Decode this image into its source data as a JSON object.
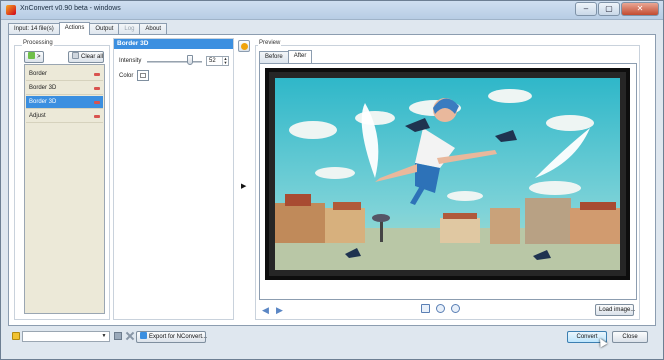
{
  "window": {
    "title": "XnConvert v0.90 beta - windows",
    "controls": [
      "–",
      "▢",
      "✕"
    ]
  },
  "tabs": [
    {
      "label": "Input: 14 file(s)",
      "active": false,
      "enabled": true
    },
    {
      "label": "Actions",
      "active": true,
      "enabled": true
    },
    {
      "label": "Output",
      "active": false,
      "enabled": true
    },
    {
      "label": "Log",
      "active": false,
      "enabled": false
    },
    {
      "label": "About",
      "active": false,
      "enabled": true
    }
  ],
  "processing": {
    "label": "Processing",
    "add_button": ">",
    "clear_button": "Clear all",
    "items": [
      {
        "label": "Border",
        "selected": false
      },
      {
        "label": "Border 3D",
        "selected": false
      },
      {
        "label": "Border 3D",
        "selected": true
      },
      {
        "label": "Adjust",
        "selected": false
      }
    ]
  },
  "settings": {
    "title": "Border 3D",
    "intensity_label": "Intensity",
    "intensity_value": "52",
    "color_label": "Color"
  },
  "preview": {
    "label": "Preview",
    "tabs": [
      {
        "label": "Before",
        "active": false
      },
      {
        "label": "After",
        "active": true
      }
    ],
    "load_image_button": "Load image..."
  },
  "footer": {
    "export_button": "Export for NConvert...",
    "convert_button": "Convert",
    "close_button": "Close"
  },
  "colors": {
    "selection": "#3b8fe0",
    "accent": "#5a86c4"
  }
}
